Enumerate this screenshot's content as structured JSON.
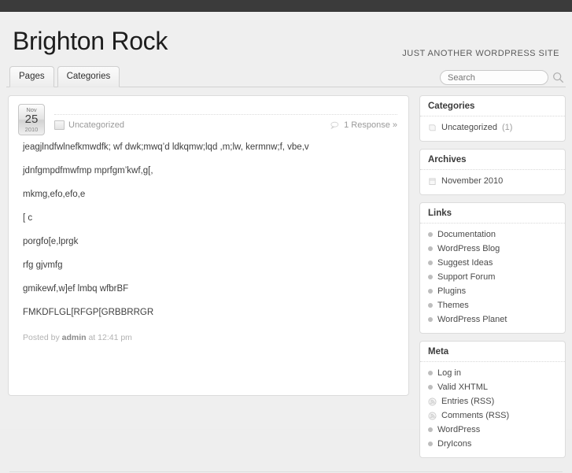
{
  "header": {
    "title": "Brighton Rock",
    "tagline": "JUST ANOTHER WORDPRESS SITE"
  },
  "nav": {
    "tabs": [
      {
        "label": "Pages"
      },
      {
        "label": "Categories"
      }
    ],
    "search": {
      "placeholder": "Search",
      "value": "",
      "icon": "search-icon"
    }
  },
  "post": {
    "date": {
      "month": "Nov",
      "day": "25",
      "year": "2010"
    },
    "category": "Uncategorized",
    "category_icon": "folder-icon",
    "responses": "1 Response »",
    "responses_icon": "comment-icon",
    "paragraphs": [
      "jeagjlndfwlnefkmwdfk; wf dwk;mwq’d ldkqmw;lqd ,m;lw, kermnw;f, vbe,v",
      "jdnfgmpdfmwfmp mprfgm’kwf,g[,",
      "mkmg,efo,efo,e",
      "[ c",
      "porgfo[e,lprgk",
      "rfg gjvmfg",
      "gmikewf,w]ef lmbq wfbrBF",
      "FMKDFLGL[RFGP[GRBBRRGR"
    ],
    "footer": {
      "prefix": "Posted by",
      "author": "admin",
      "suffix": "at 12:41 pm"
    }
  },
  "sidebar": {
    "widgets": [
      {
        "title": "Categories",
        "items": [
          {
            "label": "Uncategorized",
            "count": "(1)",
            "icon": "folder-icon"
          }
        ]
      },
      {
        "title": "Archives",
        "items": [
          {
            "label": "November 2010",
            "count": "",
            "icon": "calendar-icon"
          }
        ]
      },
      {
        "title": "Links",
        "items": [
          {
            "label": "Documentation",
            "count": "",
            "icon": "bullet-icon"
          },
          {
            "label": "WordPress Blog",
            "count": "",
            "icon": "bullet-icon"
          },
          {
            "label": "Suggest Ideas",
            "count": "",
            "icon": "bullet-icon"
          },
          {
            "label": "Support Forum",
            "count": "",
            "icon": "bullet-icon"
          },
          {
            "label": "Plugins",
            "count": "",
            "icon": "bullet-icon"
          },
          {
            "label": "Themes",
            "count": "",
            "icon": "bullet-icon"
          },
          {
            "label": "WordPress Planet",
            "count": "",
            "icon": "bullet-icon"
          }
        ]
      },
      {
        "title": "Meta",
        "items": [
          {
            "label": "Log in",
            "count": "",
            "icon": "bullet-icon"
          },
          {
            "label": "Valid XHTML",
            "count": "",
            "icon": "bullet-icon"
          },
          {
            "label": "Entries (RSS)",
            "count": "",
            "icon": "rss-icon"
          },
          {
            "label": "Comments (RSS)",
            "count": "",
            "icon": "rss-icon"
          },
          {
            "label": "WordPress",
            "count": "",
            "icon": "bullet-icon"
          },
          {
            "label": "DryIcons",
            "count": "",
            "icon": "bullet-icon"
          }
        ]
      }
    ]
  },
  "colors": {
    "topbar": "#3b3b3b",
    "page_bg": "#efefef",
    "panel_bg": "#ffffff",
    "text": "#3e3e3e",
    "muted": "#9a9a9a"
  }
}
